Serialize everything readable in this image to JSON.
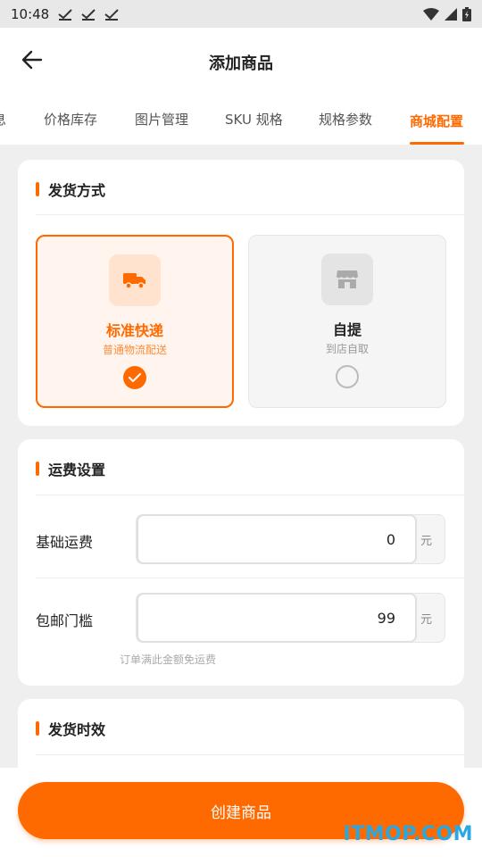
{
  "status_bar": {
    "time": "10:48"
  },
  "header": {
    "title": "添加商品"
  },
  "tabs": [
    {
      "label": "息"
    },
    {
      "label": "价格库存"
    },
    {
      "label": "图片管理"
    },
    {
      "label": "SKU 规格"
    },
    {
      "label": "规格参数"
    },
    {
      "label": "商城配置",
      "active": true
    }
  ],
  "shipping_method": {
    "title": "发货方式",
    "options": [
      {
        "name": "标准快递",
        "desc": "普通物流配送",
        "selected": true,
        "icon": "truck-icon"
      },
      {
        "name": "自提",
        "desc": "到店自取",
        "selected": false,
        "icon": "store-icon"
      }
    ]
  },
  "freight": {
    "title": "运费设置",
    "base_label": "基础运费",
    "base_value": "0",
    "base_unit": "元",
    "free_label": "包邮门槛",
    "free_value": "99",
    "free_unit": "元",
    "free_hint": "订单满此金额免运费"
  },
  "delivery_time": {
    "title": "发货时效"
  },
  "footer": {
    "create_label": "创建商品"
  },
  "watermark": "ITMOP.COM",
  "colors": {
    "accent": "#ff6a00",
    "watermark": "#2aa6e0"
  }
}
